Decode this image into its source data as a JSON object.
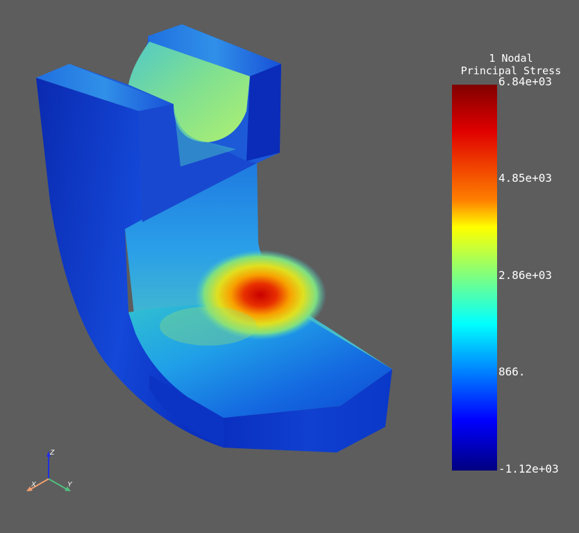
{
  "viewer": {
    "background_color": "#5d5d5d",
    "scalar_bar": {
      "title_line1": "1 Nodal",
      "title_line2": "Principal Stress",
      "colormap": "jet",
      "min": -1120,
      "max": 6840,
      "ticks": [
        {
          "label": "6.84e+03",
          "value": 6840
        },
        {
          "label": "4.85e+03",
          "value": 4850
        },
        {
          "label": "2.86e+03",
          "value": 2860
        },
        {
          "label": "866.",
          "value": 866
        },
        {
          "label": "-1.12e+03",
          "value": -1120
        }
      ]
    },
    "axes": {
      "x_label": "X",
      "y_label": "Y",
      "z_label": "Z",
      "x_color": "#f0a070",
      "y_color": "#50c080",
      "z_color": "#2030e0"
    }
  }
}
